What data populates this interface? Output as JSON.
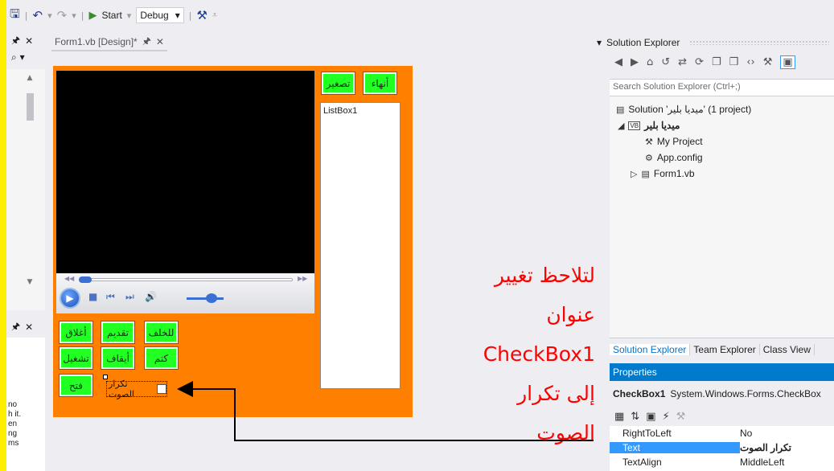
{
  "toolbar": {
    "start_label": "Start",
    "config_value": "Debug"
  },
  "left_panel": {
    "pin_label": "\u0004 ×",
    "help_lines": [
      "no",
      "h it.",
      "en",
      "ng",
      "ms"
    ]
  },
  "document": {
    "tab_title": "Form1.vb [Design]*"
  },
  "form": {
    "top_buttons": [
      "أنهاء",
      "تصغير"
    ],
    "listbox_text": "ListBox1",
    "buttons_row1": [
      "أغلاق",
      "تقديم",
      "للخلف"
    ],
    "buttons_row2": [
      "تشغيل",
      "أيقاف",
      "كتم"
    ],
    "open_button": "فتح",
    "checkbox_label": "تكرار الصوت"
  },
  "annotation": {
    "lines": [
      "لتلاحظ تغيير",
      "عنوان",
      "CheckBox1",
      "إلى تكرار",
      "الصوت"
    ],
    "color": "#ff0000"
  },
  "solution_explorer": {
    "title": "Solution Explorer",
    "search_placeholder": "Search Solution Explorer (Ctrl+;)",
    "tree": [
      {
        "label": "Solution 'ميديا بلير' (1 project)",
        "icon": "solution-icon"
      },
      {
        "label": "ميديا بلير",
        "icon": "vb-project-icon"
      },
      {
        "label": "My Project",
        "icon": "wrench-icon"
      },
      {
        "label": "App.config",
        "icon": "config-icon"
      },
      {
        "label": "Form1.vb",
        "icon": "form-icon"
      }
    ],
    "tabs": [
      "Solution Explorer",
      "Team Explorer",
      "Class View"
    ]
  },
  "properties": {
    "title": "Properties",
    "object_name": "CheckBox1",
    "object_type": "System.Windows.Forms.CheckBox",
    "rows": [
      {
        "name": "RightToLeft",
        "value": "No"
      },
      {
        "name": "Text",
        "value": "تكرار الصوت"
      },
      {
        "name": "TextAlign",
        "value": "MiddleLeft"
      }
    ]
  },
  "colors": {
    "form_background": "#ff8000",
    "button_green": "#22ff22",
    "accent_blue": "#007acc"
  }
}
